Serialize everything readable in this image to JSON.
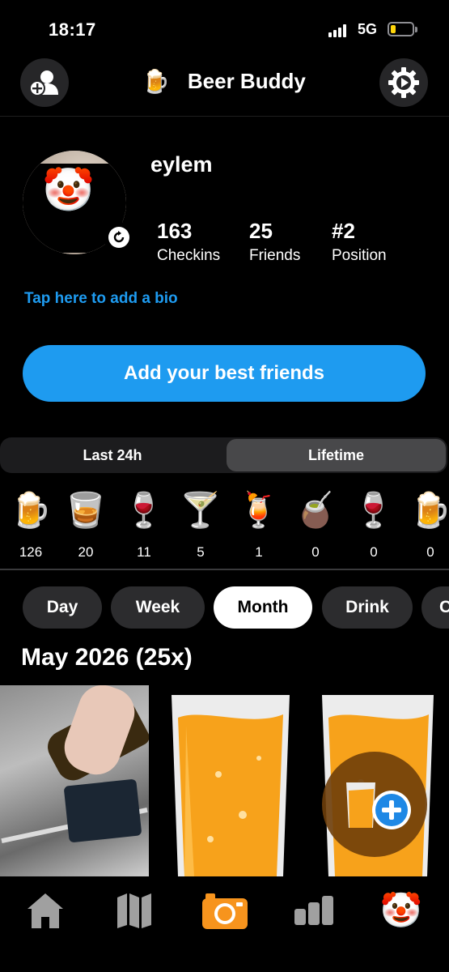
{
  "status_bar": {
    "time": "18:17",
    "network": "5G"
  },
  "header": {
    "app_title": "Beer Buddy",
    "logo_icon": "beer-mug-icon",
    "left_icon": "add-friend-icon",
    "right_icon": "settings-gear-icon"
  },
  "profile": {
    "username": "eylem",
    "avatar_emoji": "🤡",
    "stats": [
      {
        "value": "163",
        "label": "Checkins"
      },
      {
        "value": "25",
        "label": "Friends"
      },
      {
        "value": "#2",
        "label": "Position"
      }
    ],
    "bio_prompt": "Tap here to add a bio",
    "add_friends_label": "Add your best friends"
  },
  "timeframe": {
    "options": [
      "Last 24h",
      "Lifetime"
    ],
    "selected": "Lifetime"
  },
  "drinks": [
    {
      "icon": "🍺",
      "count": "126"
    },
    {
      "icon": "🥃",
      "count": "20"
    },
    {
      "icon": "🍷",
      "count": "11"
    },
    {
      "icon": "🍸",
      "count": "5"
    },
    {
      "icon": "🍹",
      "count": "1"
    },
    {
      "icon": "🧉",
      "count": "0"
    },
    {
      "icon": "🍷",
      "count": "0"
    },
    {
      "icon": "🍺",
      "count": "0"
    }
  ],
  "period_tabs": [
    "Day",
    "Week",
    "Month",
    "Drink",
    "C"
  ],
  "period_selected": "Month",
  "feed": {
    "month_title": "May 2026 (25x)"
  },
  "tabbar": {
    "items": [
      "home-icon",
      "map-icon",
      "camera-icon",
      "stats-icon",
      "profile-icon"
    ],
    "profile_emoji": "🤡"
  },
  "colors": {
    "accent": "#1e9bf0",
    "background": "#000000",
    "beer": "#f7a21b"
  }
}
